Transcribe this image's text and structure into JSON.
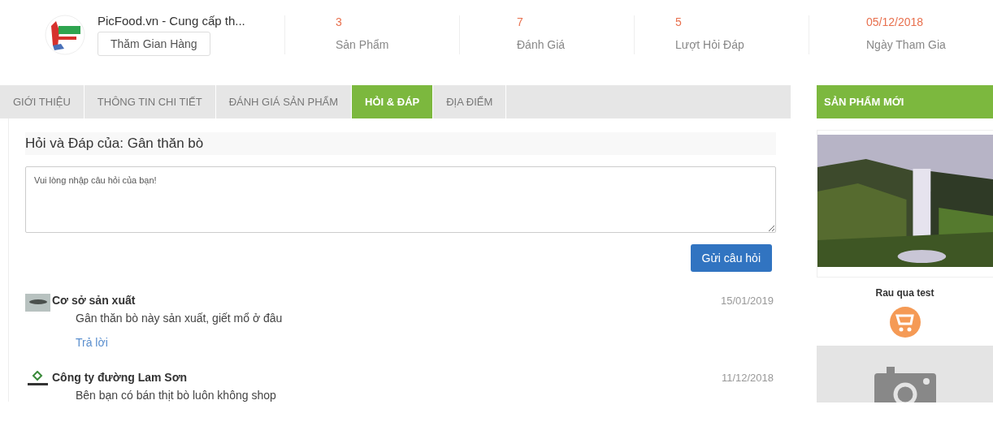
{
  "shop": {
    "name": "PicFood.vn - Cung cấp th...",
    "visit_button": "Thăm Gian Hàng"
  },
  "stats": [
    {
      "value": "3",
      "label": "Sản Phẩm"
    },
    {
      "value": "7",
      "label": "Đánh Giá"
    },
    {
      "value": "5",
      "label": "Lượt Hỏi Đáp"
    },
    {
      "value": "05/12/2018",
      "label": "Ngày Tham Gia"
    }
  ],
  "tabs": [
    {
      "label": "GIỚI THIỆU",
      "selected": false
    },
    {
      "label": "THÔNG TIN CHI TIẾT",
      "selected": false
    },
    {
      "label": "ĐÁNH GIÁ SẢN PHẨM",
      "selected": false
    },
    {
      "label": "HỎI & ĐÁP",
      "selected": true
    },
    {
      "label": "ĐỊA ĐIỂM",
      "selected": false
    }
  ],
  "qa": {
    "heading": "Hỏi và Đáp của: Gân thăn bò",
    "placeholder": "Vui lòng nhập câu hỏi của bạn!",
    "submit": "Gửi câu hỏi",
    "questions": [
      {
        "author": "Cơ sở sản xuất",
        "date": "15/01/2019",
        "text": "Gân thăn bò này sản xuất, giết mổ ở đâu",
        "reply": "Trả lời"
      },
      {
        "kind": "logo",
        "author": "Công ty đường Lam Sơn",
        "date": "11/12/2018",
        "text": "Bên bạn có bán thịt bò luôn không shop"
      }
    ]
  },
  "sidebar": {
    "title": "SẢN PHẨM MỚI",
    "products": [
      {
        "kind": "picture",
        "name": "Rau qua test"
      },
      {
        "kind": "placeholder"
      }
    ]
  }
}
